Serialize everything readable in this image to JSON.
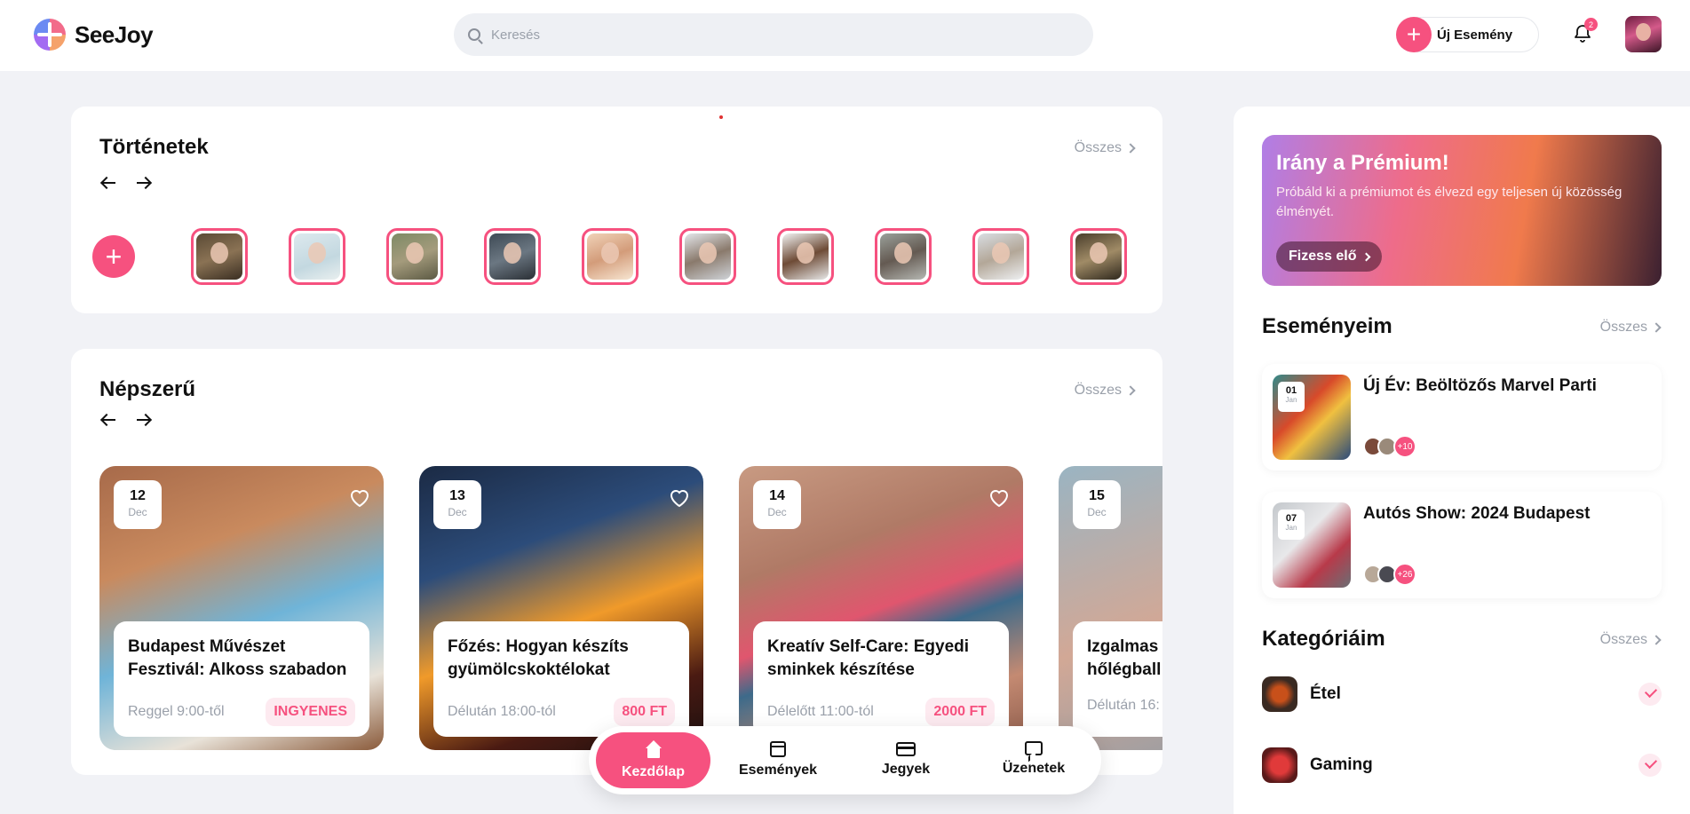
{
  "app": {
    "name": "SeeJoy"
  },
  "header": {
    "search_placeholder": "Keresés",
    "new_event_label": "Új Esemény",
    "notification_count": "2"
  },
  "stories": {
    "title": "Történetek",
    "see_all": "Összes",
    "items": [
      "story-1",
      "story-2",
      "story-3",
      "story-4",
      "story-5",
      "story-6",
      "story-7",
      "story-8",
      "story-9",
      "story-10"
    ]
  },
  "popular": {
    "title": "Népszerű",
    "see_all": "Összes",
    "events": [
      {
        "day": "12",
        "month": "Dec",
        "title": "Budapest Művészet Fesztivál: Alkoss szabadon",
        "time": "Reggel 9:00-től",
        "price": "INGYENES"
      },
      {
        "day": "13",
        "month": "Dec",
        "title": "Főzés: Hogyan készíts gyümölcskoktélokat",
        "time": "Délután 18:00-tól",
        "price": "800 FT"
      },
      {
        "day": "14",
        "month": "Dec",
        "title": "Kreatív Self-Care: Egyedi sminkek készítése",
        "time": "Délelőtt 11:00-tól",
        "price": "2000 FT"
      },
      {
        "day": "15",
        "month": "Dec",
        "title": "Izgalmas hőlégball",
        "time": "Délután 16:",
        "price": ""
      }
    ]
  },
  "bottom_nav": {
    "home": "Kezdőlap",
    "events": "Események",
    "tickets": "Jegyek",
    "messages": "Üzenetek"
  },
  "sidebar": {
    "premium": {
      "title": "Irány a Prémium!",
      "text": "Próbáld ki a prémiumot és élvezd egy teljesen új közösség élményét.",
      "button": "Fizess elő"
    },
    "my_events": {
      "title": "Eseményeim",
      "see_all": "Összes",
      "items": [
        {
          "day": "01",
          "month": "Jan",
          "title": "Új Év: Beöltözős Marvel Parti",
          "more": "+10"
        },
        {
          "day": "07",
          "month": "Jan",
          "title": "Autós Show: 2024 Budapest",
          "more": "+26"
        }
      ]
    },
    "categories": {
      "title": "Kategóriáim",
      "see_all": "Összes",
      "items": [
        {
          "label": "Étel"
        },
        {
          "label": "Gaming"
        }
      ]
    }
  },
  "colors": {
    "accent": "#f6517f",
    "accent_light": "#fdeaf0",
    "background": "#f1f2f6"
  }
}
